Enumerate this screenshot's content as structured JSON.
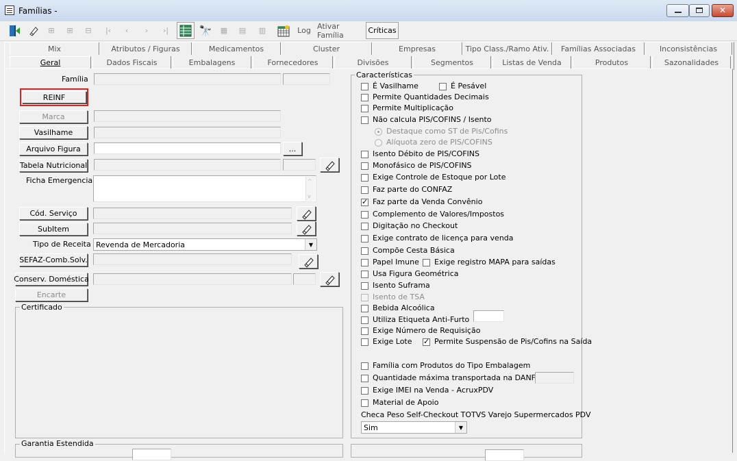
{
  "window": {
    "title": "Famílias -"
  },
  "toolbar": {
    "log": "Log",
    "ativar_familia": "Ativar Família",
    "criticas": "Críticas"
  },
  "tabs_row1": [
    "Mix",
    "Atributos / Figuras",
    "Medicamentos",
    "Cluster",
    "Empresas",
    "Tipo Class./Ramo Ativ.",
    "Famílias Associadas",
    "Inconsistências"
  ],
  "tabs_row2": [
    "Geral",
    "Dados Fiscais",
    "Embalagens",
    "Fornecedores",
    "Divisões",
    "Segmentos",
    "Listas de Venda",
    "Produtos",
    "Sazonalidades"
  ],
  "form": {
    "familia_label": "Família",
    "reinf": "REINF",
    "marca": "Marca",
    "vasilhame": "Vasilhame",
    "arquivo_figura": "Arquivo Figura",
    "browse": "...",
    "tabela_nutricional": "Tabela Nutricional",
    "ficha_emergencial": "Ficha Emergencial",
    "cod_servico": "Cód. Serviço",
    "subitem": "SubItem",
    "tipo_receita_label": "Tipo de Receita",
    "tipo_receita_value": "Revenda de Mercadoria",
    "sefaz": "SEFAZ-Comb.Solv.",
    "conserv_domestica": "Conserv. Doméstica",
    "encarte": "Encarte",
    "certificado": "Certificado",
    "garantia": "Garantia Estendida"
  },
  "caracteristicas": {
    "title": "Características",
    "e_vasilhame": "É Vasilhame",
    "e_pesavel": "É Pesável",
    "perm_qtd_dec": "Permite Quantidades Decimais",
    "perm_mult": "Permite Multiplicação",
    "nao_calcula": "Não calcula PIS/COFINS / Isento",
    "destaque": "Destaque como ST de Pis/Cofins",
    "aliquota": "Alíquota zero de PIS/COFINS",
    "isento_debito": "Isento Débito de PIS/COFINS",
    "monofasico": "Monofásico de PIS/COFINS",
    "exige_lote_estoque": "Exige Controle de Estoque por Lote",
    "confaz": "Faz parte do CONFAZ",
    "venda_convenio": "Faz parte da Venda Convênio",
    "complemento": "Complemento de Valores/Impostos",
    "digitacao": "Digitação no Checkout",
    "contrato": "Exige contrato de licença para venda",
    "cesta": "Compõe Cesta Básica",
    "papel_imune": "Papel Imune",
    "mapa": "Exige registro MAPA para saídas",
    "figura_geo": "Usa Figura Geométrica",
    "suframa": "Isento Suframa",
    "tsa": "Isento de TSA",
    "bebida": "Bebida Alcoólica",
    "antifurto": "Utiliza Etiqueta Anti-Furto",
    "requisicao": "Exige Número de Requisição",
    "exige_lote": "Exige Lote",
    "susp_pis": "Permite Suspensão de Pis/Cofins na Saída",
    "familia_embalagem": "Família com Produtos do Tipo Embalagem",
    "qtd_danfe": "Quantidade máxima transportada na DANFE (KG)",
    "imei": "Exige IMEI na Venda - AcruxPDV",
    "material_apoio": "Material de Apoio",
    "checa_peso": "Checa Peso Self-Checkout TOTVS Varejo Supermercados PDV",
    "checa_peso_value": "Sim"
  }
}
